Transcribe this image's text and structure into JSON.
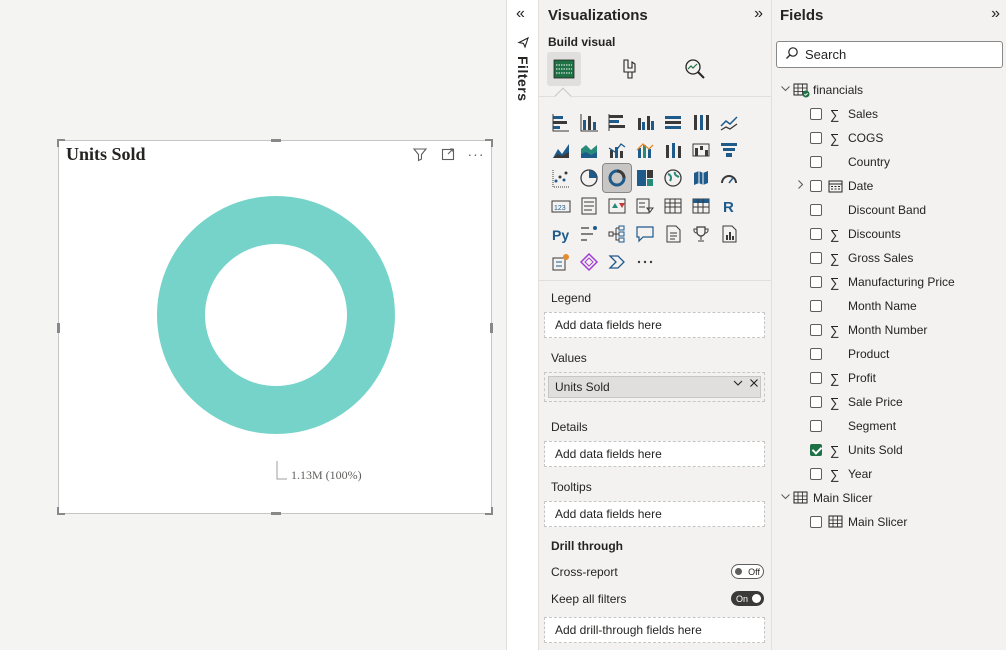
{
  "visual": {
    "title": "Units Sold",
    "filter_icon": "filter-icon",
    "focus_icon": "focus-mode-icon",
    "more_icon": "more-options-icon",
    "more_label": "···"
  },
  "chart_data": {
    "type": "pie",
    "subtype": "donut",
    "title": "Units Sold",
    "slices": [
      {
        "label": "1.13M (100%)",
        "value": 1130000,
        "percent": 100,
        "color": "#76d3c9"
      }
    ],
    "data_label": "1.13M (100%)"
  },
  "filters": {
    "label": "Filters",
    "collapse_glyph": "«"
  },
  "visualizations": {
    "title": "Visualizations",
    "expand_glyph": "»",
    "build_visual": "Build visual",
    "more_visuals": "···",
    "wells": {
      "legend": {
        "label": "Legend",
        "placeholder": "Add data fields here"
      },
      "values": {
        "label": "Values",
        "field": "Units Sold"
      },
      "details": {
        "label": "Details",
        "placeholder": "Add data fields here"
      },
      "tooltips": {
        "label": "Tooltips",
        "placeholder": "Add data fields here"
      }
    },
    "drill_through": {
      "title": "Drill through",
      "cross_report": {
        "label": "Cross-report",
        "state": "Off"
      },
      "keep_all_filters": {
        "label": "Keep all filters",
        "state": "On"
      },
      "placeholder": "Add drill-through fields here"
    }
  },
  "fields": {
    "title": "Fields",
    "expand_glyph": "»",
    "search_placeholder": "Search",
    "tables": [
      {
        "name": "financials",
        "items": [
          {
            "name": "Sales",
            "sigma": true,
            "checked": false
          },
          {
            "name": "COGS",
            "sigma": true,
            "checked": false
          },
          {
            "name": "Country",
            "sigma": false,
            "checked": false
          },
          {
            "name": "Date",
            "sigma": false,
            "checked": false,
            "calendar": true,
            "expandable": true
          },
          {
            "name": "Discount Band",
            "sigma": false,
            "checked": false
          },
          {
            "name": "Discounts",
            "sigma": true,
            "checked": false
          },
          {
            "name": "Gross Sales",
            "sigma": true,
            "checked": false
          },
          {
            "name": "Manufacturing Price",
            "sigma": true,
            "checked": false
          },
          {
            "name": "Month Name",
            "sigma": false,
            "checked": false
          },
          {
            "name": "Month Number",
            "sigma": true,
            "checked": false
          },
          {
            "name": "Product",
            "sigma": false,
            "checked": false
          },
          {
            "name": "Profit",
            "sigma": true,
            "checked": false
          },
          {
            "name": "Sale Price",
            "sigma": true,
            "checked": false
          },
          {
            "name": "Segment",
            "sigma": false,
            "checked": false
          },
          {
            "name": "Units Sold",
            "sigma": true,
            "checked": true
          },
          {
            "name": "Year",
            "sigma": true,
            "checked": false
          }
        ]
      },
      {
        "name": "Main Slicer",
        "items": [
          {
            "name": "Main Slicer",
            "sigma": false,
            "checked": false,
            "table_icon": true
          }
        ]
      }
    ]
  }
}
